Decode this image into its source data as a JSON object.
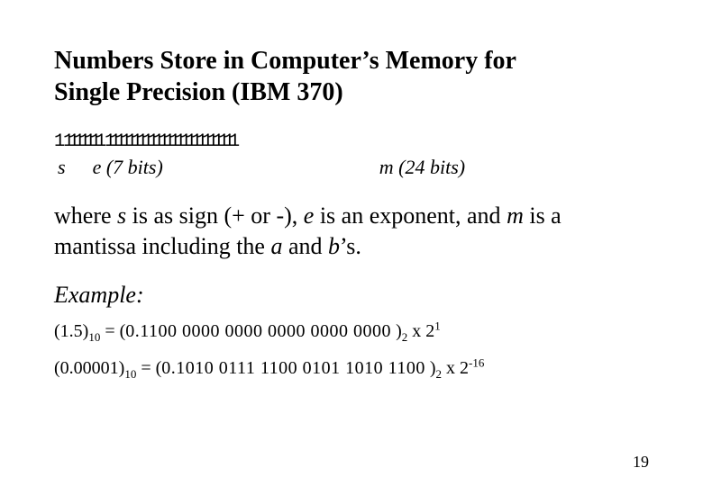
{
  "title_line1": "Numbers Store in Computer’s Memory for",
  "title_line2": "Single Precision (IBM 370)",
  "bit_layout": {
    "sign_bits": "1",
    "exponent_bits": "1111111",
    "mantissa_bits": "111111111111111111111111"
  },
  "labels": {
    "s": "s",
    "e": "e (7 bits)",
    "m": "m (24 bits)"
  },
  "body": {
    "p1": "where ",
    "s": "s",
    "p2": " is as sign (+ or -), ",
    "e": "e",
    "p3": " is an exponent, and ",
    "m": "m",
    "p4": " is a mantissa including the ",
    "a": "a",
    "p5": " and ",
    "b": "b",
    "p6": "’s."
  },
  "example_label": "Example:",
  "equations": {
    "eq1": {
      "lhs_value": "1.5",
      "lhs_base": "10",
      "rhs_mantissa": "0.1100  0000  0000  0000  0000  0000",
      "rhs_base": "2",
      "exp_text": "x 2",
      "exp_value": "1"
    },
    "eq2": {
      "lhs_value": "0.00001",
      "lhs_base": "10",
      "rhs_mantissa": "0.1010  0111 1100  0101  1010 1100",
      "rhs_base": "2",
      "exp_text": "x 2",
      "exp_value": "-16"
    }
  },
  "page_number": "19"
}
